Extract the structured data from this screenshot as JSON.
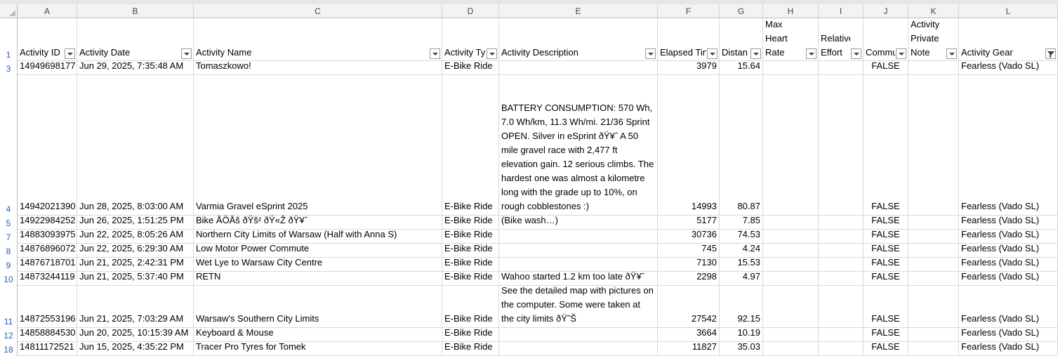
{
  "columns": [
    "A",
    "B",
    "C",
    "D",
    "E",
    "F",
    "G",
    "H",
    "I",
    "J",
    "K",
    "L"
  ],
  "header_row_number": "1",
  "headers": [
    "Activity ID",
    "Activity Date",
    "Activity Name",
    "Activity Typ",
    "Activity Description",
    "Elapsed Tin",
    "Distan",
    "Max Heart Rate",
    "Relative Effort",
    "Commu",
    "Activity Private Note",
    "Activity Gear"
  ],
  "rows": [
    {
      "n": "3",
      "id": "14949698177",
      "date": "Jun 29, 2025, 7:35:48 AM",
      "name": "Tomaszkowo!",
      "type": "E-Bike Ride",
      "desc": "",
      "elapsed": "3979",
      "dist": "15.64",
      "commute": "FALSE",
      "gear": "Fearless (Vado SL)"
    },
    {
      "n": "4",
      "id": "14942021390",
      "date": "Jun 28, 2025, 8:03:00 AM",
      "name": "Varmia Gravel eSprint 2025",
      "type": "E-Bike Ride",
      "desc": "BATTERY CONSUMPTION: 570 Wh, 7.0 Wh/km, 11.3 Wh/mi. 21/36 Sprint OPEN. Silver in eSprint ðŸ¥ˆ A 50 mile gravel race with 2,477 ft elevation gain. 12 serious climbs. The hardest one was almost a kilometre long with the grade up to 10%, on rough cobblestones :)",
      "elapsed": "14993",
      "dist": "80.87",
      "commute": "FALSE",
      "gear": "Fearless (Vado SL)"
    },
    {
      "n": "5",
      "id": "14922984252",
      "date": "Jun 26, 2025, 1:51:25 PM",
      "name": "Bike ÅÖÅš ðŸš² ðŸ«Ž ðŸ¥ˆ",
      "type": "E-Bike Ride",
      "desc": "(Bike wash…)",
      "elapsed": "5177",
      "dist": "7.85",
      "commute": "FALSE",
      "gear": "Fearless (Vado SL)"
    },
    {
      "n": "7",
      "id": "14883093975",
      "date": "Jun 22, 2025, 8:05:26 AM",
      "name": "Northern City Limits of Warsaw (Half with Anna S)",
      "type": "E-Bike Ride",
      "desc": "",
      "elapsed": "30736",
      "dist": "74.53",
      "commute": "FALSE",
      "gear": "Fearless (Vado SL)"
    },
    {
      "n": "8",
      "id": "14876896072",
      "date": "Jun 22, 2025, 6:29:30 AM",
      "name": "Low Motor Power Commute",
      "type": "E-Bike Ride",
      "desc": "",
      "elapsed": "745",
      "dist": "4.24",
      "commute": "FALSE",
      "gear": "Fearless (Vado SL)"
    },
    {
      "n": "9",
      "id": "14876718701",
      "date": "Jun 21, 2025, 2:42:31 PM",
      "name": "Wet Lye to Warsaw City Centre",
      "type": "E-Bike Ride",
      "desc": "",
      "elapsed": "7130",
      "dist": "15.53",
      "commute": "FALSE",
      "gear": "Fearless (Vado SL)"
    },
    {
      "n": "10",
      "id": "14873244119",
      "date": "Jun 21, 2025, 5:37:40 PM",
      "name": "RETN",
      "type": "E-Bike Ride",
      "desc": "Wahoo started 1.2 km too late ðŸ¥ˆ",
      "elapsed": "2298",
      "dist": "4.97",
      "commute": "FALSE",
      "gear": "Fearless (Vado SL)"
    },
    {
      "n": "11",
      "id": "14872553196",
      "date": "Jun 21, 2025, 7:03:29 AM",
      "name": "Warsaw's Southern City Limits",
      "type": "E-Bike Ride",
      "desc": "See the detailed map with pictures on the computer. Some were taken at the city limits ðŸ˜Š",
      "elapsed": "27542",
      "dist": "92.15",
      "commute": "FALSE",
      "gear": "Fearless (Vado SL)"
    },
    {
      "n": "12",
      "id": "14858884530",
      "date": "Jun 20, 2025, 10:15:39 AM",
      "name": "Keyboard & Mouse",
      "type": "E-Bike Ride",
      "desc": "",
      "elapsed": "3664",
      "dist": "10.19",
      "commute": "FALSE",
      "gear": "Fearless (Vado SL)"
    },
    {
      "n": "18",
      "id": "14811172521",
      "date": "Jun 15, 2025, 4:35:22 PM",
      "name": "Tracer Pro Tyres for Tomek",
      "type": "E-Bike Ride",
      "desc": "",
      "elapsed": "11827",
      "dist": "35.03",
      "commute": "FALSE",
      "gear": "Fearless (Vado SL)"
    }
  ]
}
